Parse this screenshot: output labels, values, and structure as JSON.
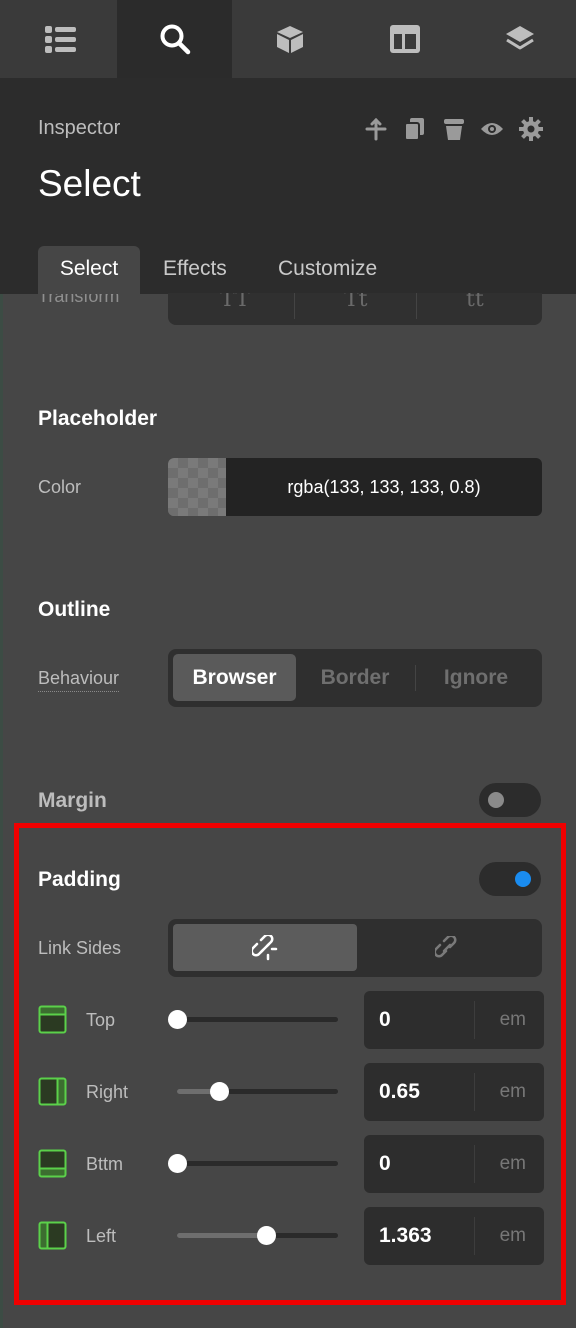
{
  "top_tabs": [
    {
      "icon": "list-icon",
      "active": false
    },
    {
      "icon": "search-icon",
      "active": true
    },
    {
      "icon": "cube-icon",
      "active": false
    },
    {
      "icon": "layout-icon",
      "active": false
    },
    {
      "icon": "layers-icon",
      "active": false
    }
  ],
  "header": {
    "section_label": "Inspector",
    "element_name": "Select",
    "actions": [
      "move-up-icon",
      "duplicate-icon",
      "delete-icon",
      "eye-icon",
      "gear-icon"
    ]
  },
  "sub_tabs": {
    "items": [
      "Select",
      "Effects",
      "Customize"
    ],
    "active": "Select"
  },
  "transform": {
    "label": "Transform",
    "options": [
      "TT",
      "Tt",
      "tt"
    ]
  },
  "placeholder": {
    "title": "Placeholder",
    "color_label": "Color",
    "color_value": "rgba(133, 133, 133, 0.8)"
  },
  "outline": {
    "title": "Outline",
    "behaviour_label": "Behaviour",
    "options": [
      "Browser",
      "Border",
      "Ignore"
    ],
    "selected": "Browser"
  },
  "margin": {
    "title": "Margin",
    "enabled": false
  },
  "padding": {
    "title": "Padding",
    "enabled": true,
    "link_sides_label": "Link Sides",
    "link_sides_selected": "linked",
    "sides": [
      {
        "label": "Top",
        "value": "0",
        "unit": "em",
        "slider_fraction": 0.0
      },
      {
        "label": "Right",
        "value": "0.65",
        "unit": "em",
        "slider_fraction": 0.26
      },
      {
        "label": "Bttm",
        "value": "0",
        "unit": "em",
        "slider_fraction": 0.0
      },
      {
        "label": "Left",
        "value": "1.363",
        "unit": "em",
        "slider_fraction": 0.55
      }
    ]
  },
  "colors": {
    "accent_blue": "#1a8cf0",
    "highlight_border": "#f00000",
    "side_icon_green": "#5bd14a"
  }
}
